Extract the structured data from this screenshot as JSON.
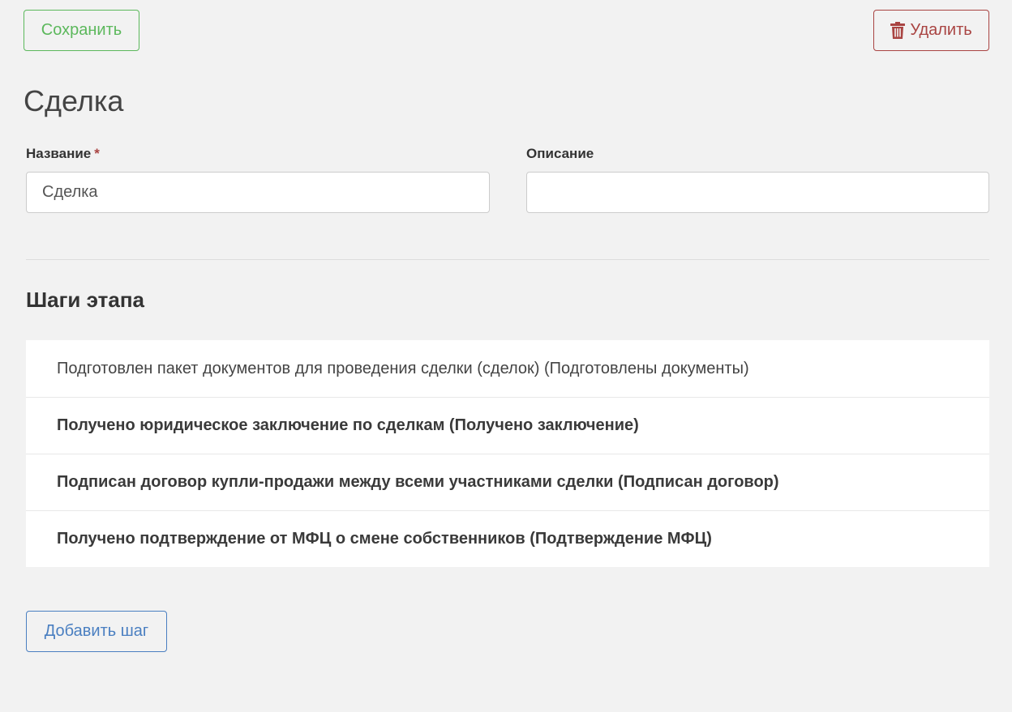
{
  "toolbar": {
    "save_label": "Сохранить",
    "delete_label": "Удалить"
  },
  "page": {
    "title": "Сделка"
  },
  "form": {
    "name_label": "Название",
    "name_required_mark": "*",
    "name_value": "Сделка",
    "description_label": "Описание",
    "description_value": ""
  },
  "steps": {
    "title": "Шаги этапа",
    "items": [
      {
        "label": "Подготовлен пакет документов для проведения сделки (сделок) (Подготовлены документы)"
      },
      {
        "label": "Получено юридическое заключение по сделкам (Получено заключение)"
      },
      {
        "label": "Подписан договор купли-продажи между всеми участниками сделки (Подписан договор)"
      },
      {
        "label": "Получено подтверждение от МФЦ о смене собственников (Подтверждение МФЦ)"
      }
    ],
    "add_label": "Добавить шаг"
  },
  "icons": {
    "delete": "trash-icon"
  },
  "colors": {
    "save": "#5cb85c",
    "delete": "#a94442",
    "add": "#4a7fc1",
    "background": "#f2f2f2"
  }
}
